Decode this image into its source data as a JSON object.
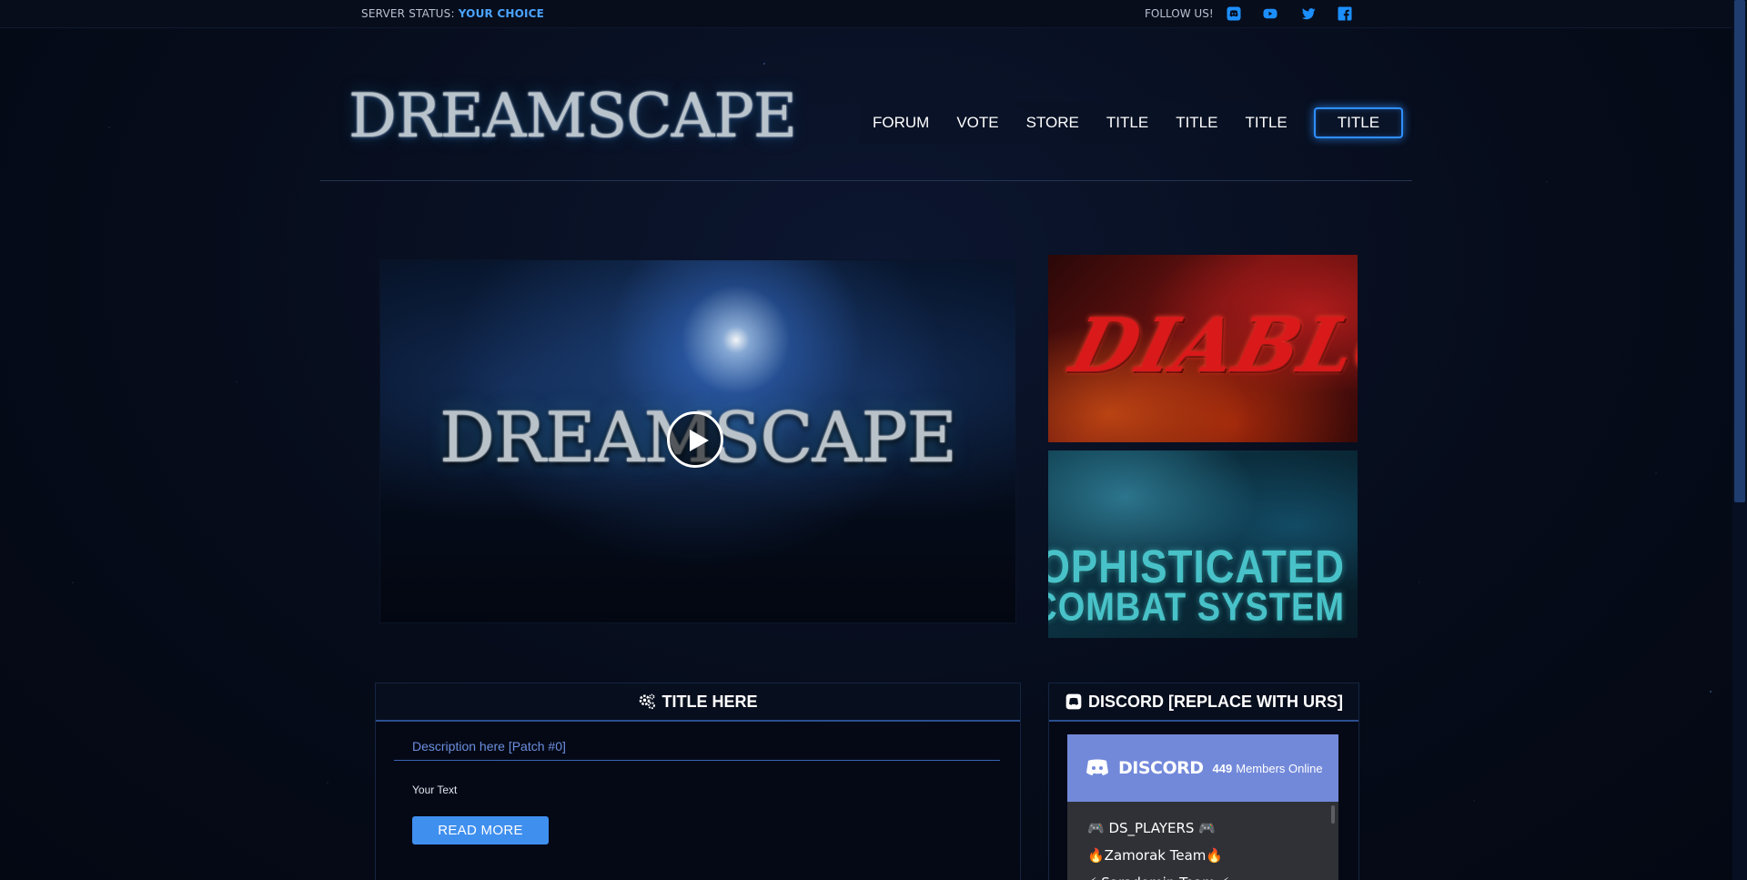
{
  "topbar": {
    "status_label": "SERVER STATUS:",
    "status_value": "YOUR CHOICE",
    "follow_label": "FOLLOW US!",
    "social_icons": [
      "discord-icon",
      "youtube-icon",
      "twitter-icon",
      "facebook-icon"
    ]
  },
  "header": {
    "logo_text": "DREAMSCAPE",
    "nav": [
      "FORUM",
      "VOTE",
      "STORE",
      "TITLE",
      "TITLE",
      "TITLE"
    ],
    "nav_highlight": "TITLE"
  },
  "video": {
    "title": "DREAMSCAPE"
  },
  "banners": {
    "diablo": "DIABLO",
    "combat_line1": "SOPHISTICATED",
    "combat_line2": "COMBAT SYSTEM"
  },
  "news": {
    "heading": "TITLE HERE",
    "post_title": "Description here [Patch #0]",
    "post_body": "Your Text",
    "button": "READ MORE"
  },
  "discord": {
    "heading": "DISCORD [REPLACE WITH URS]",
    "word": "DISCORD",
    "member_count": "449",
    "member_label": "Members Online",
    "channels": [
      "🎮 DS_PLAYERS 🎮",
      "🔥Zamorak Team🔥",
      "⚡ Saradomin Team ⚡"
    ]
  },
  "colors": {
    "accent": "#3f8fef",
    "discord": "#7289da",
    "status": "#4aa3ff"
  }
}
